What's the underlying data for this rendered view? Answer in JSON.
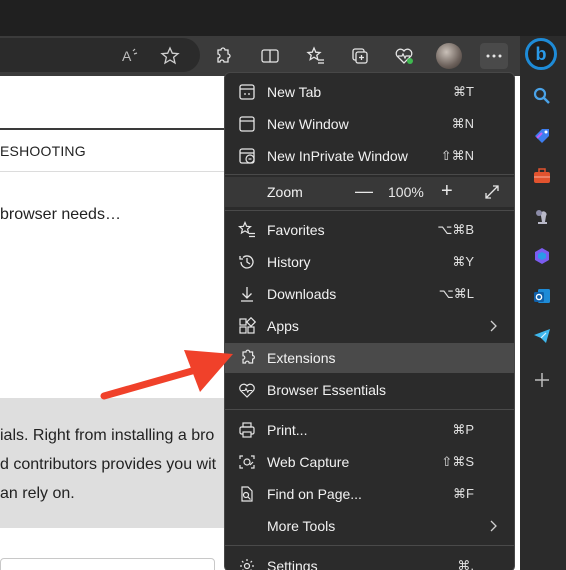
{
  "page": {
    "nav_text": "ESHOOTING",
    "snippet": "browser needs…",
    "gray_lines": [
      "ials. Right from installing a bro",
      "d contributors provides you wit",
      "an rely on."
    ]
  },
  "toolbar": {
    "icons": [
      "read-aloud-icon",
      "favorite-star-icon",
      "extensions-icon",
      "split-screen-icon",
      "favorites-icon",
      "collections-icon",
      "browser-essentials-icon",
      "profile-avatar",
      "more-icon",
      "bing-icon"
    ],
    "bing_letter": "b"
  },
  "menu": {
    "items": [
      {
        "label": "New Tab",
        "shortcut": "⌘T",
        "icon": "new-tab-icon"
      },
      {
        "label": "New Window",
        "shortcut": "⌘N",
        "icon": "new-window-icon"
      },
      {
        "label": "New InPrivate Window",
        "shortcut": "⇧⌘N",
        "icon": "inprivate-icon"
      },
      {
        "label": "Favorites",
        "shortcut": "⌥⌘B",
        "icon": "favorites-icon"
      },
      {
        "label": "History",
        "shortcut": "⌘Y",
        "icon": "history-icon"
      },
      {
        "label": "Downloads",
        "shortcut": "⌥⌘L",
        "icon": "downloads-icon"
      },
      {
        "label": "Apps",
        "shortcut": "",
        "icon": "apps-icon"
      },
      {
        "label": "Extensions",
        "shortcut": "",
        "icon": "extensions-icon"
      },
      {
        "label": "Browser Essentials",
        "shortcut": "",
        "icon": "browser-essentials-icon"
      },
      {
        "label": "Print...",
        "shortcut": "⌘P",
        "icon": "print-icon"
      },
      {
        "label": "Web Capture",
        "shortcut": "⇧⌘S",
        "icon": "web-capture-icon"
      },
      {
        "label": "Find on Page...",
        "shortcut": "⌘F",
        "icon": "find-icon"
      },
      {
        "label": "More Tools",
        "shortcut": "",
        "icon": "more-tools"
      },
      {
        "label": "Settings",
        "shortcut": "⌘,",
        "icon": "settings-icon"
      }
    ],
    "zoom": {
      "label": "Zoom",
      "minus": "—",
      "value": "100%",
      "plus": "+"
    },
    "highlighted": "Extensions"
  },
  "sidebar": {
    "icons": [
      "search-icon",
      "shopping-tag-icon",
      "tools-icon",
      "games-icon",
      "microsoft-365-icon",
      "outlook-icon",
      "telegram-icon",
      "add-icon"
    ]
  },
  "colors": {
    "menu_bg": "#2b2b2b",
    "highlight": "#4a4a4a",
    "arrow": "#f0412a",
    "bing_blue": "#1e8bd7"
  }
}
